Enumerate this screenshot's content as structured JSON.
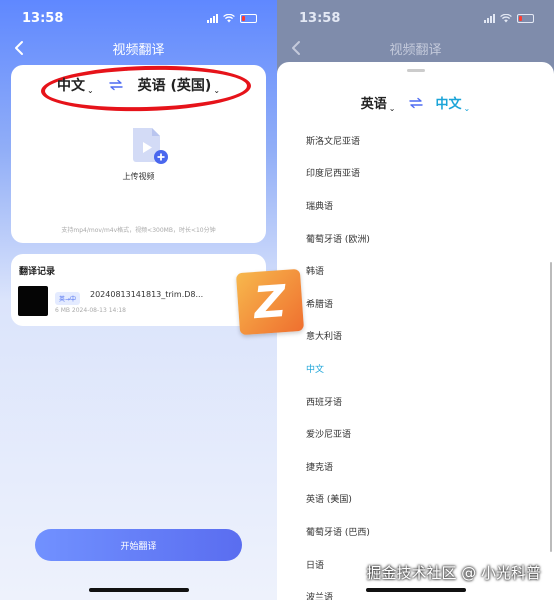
{
  "left": {
    "status": {
      "time": "13:58"
    },
    "nav": {
      "title": "视频翻译"
    },
    "source_lang": "中文",
    "target_lang": "英语 (英国)",
    "upload_label": "上传视频",
    "format_note": "支持mp4/mov/m4v格式，视频<300MB，时长<10分钟",
    "history": {
      "title": "翻译记录",
      "item": {
        "badge": "英→中",
        "name": "20240813141813_trim.D8...",
        "meta": "6 MB 2024-08-13 14:18"
      }
    },
    "start_button": "开始翻译"
  },
  "right": {
    "status": {
      "time": "13:58"
    },
    "nav": {
      "title": "视频翻译"
    },
    "source_lang": "英语",
    "target_lang": "中文",
    "languages": [
      "斯洛文尼亚语",
      "印度尼西亚语",
      "瑞典语",
      "葡萄牙语 (欧洲)",
      "韩语",
      "希腊语",
      "意大利语",
      "中文",
      "西班牙语",
      "爱沙尼亚语",
      "捷克语",
      "英语 (美国)",
      "葡萄牙语 (巴西)",
      "日语",
      "波兰语"
    ],
    "selected_language": "中文"
  },
  "overlay": {
    "logo_letter": "Z",
    "watermark": "掘金技术社区 @ 小光科普"
  },
  "colors": {
    "accent_blue": "#5a6df0",
    "selected_cyan": "#1ba4d8",
    "annotation_red": "#e6131a"
  },
  "icons": [
    "back-chevron-icon",
    "swap-arrows-icon",
    "video-upload-icon",
    "signal-icon",
    "wifi-icon",
    "battery-icon"
  ]
}
